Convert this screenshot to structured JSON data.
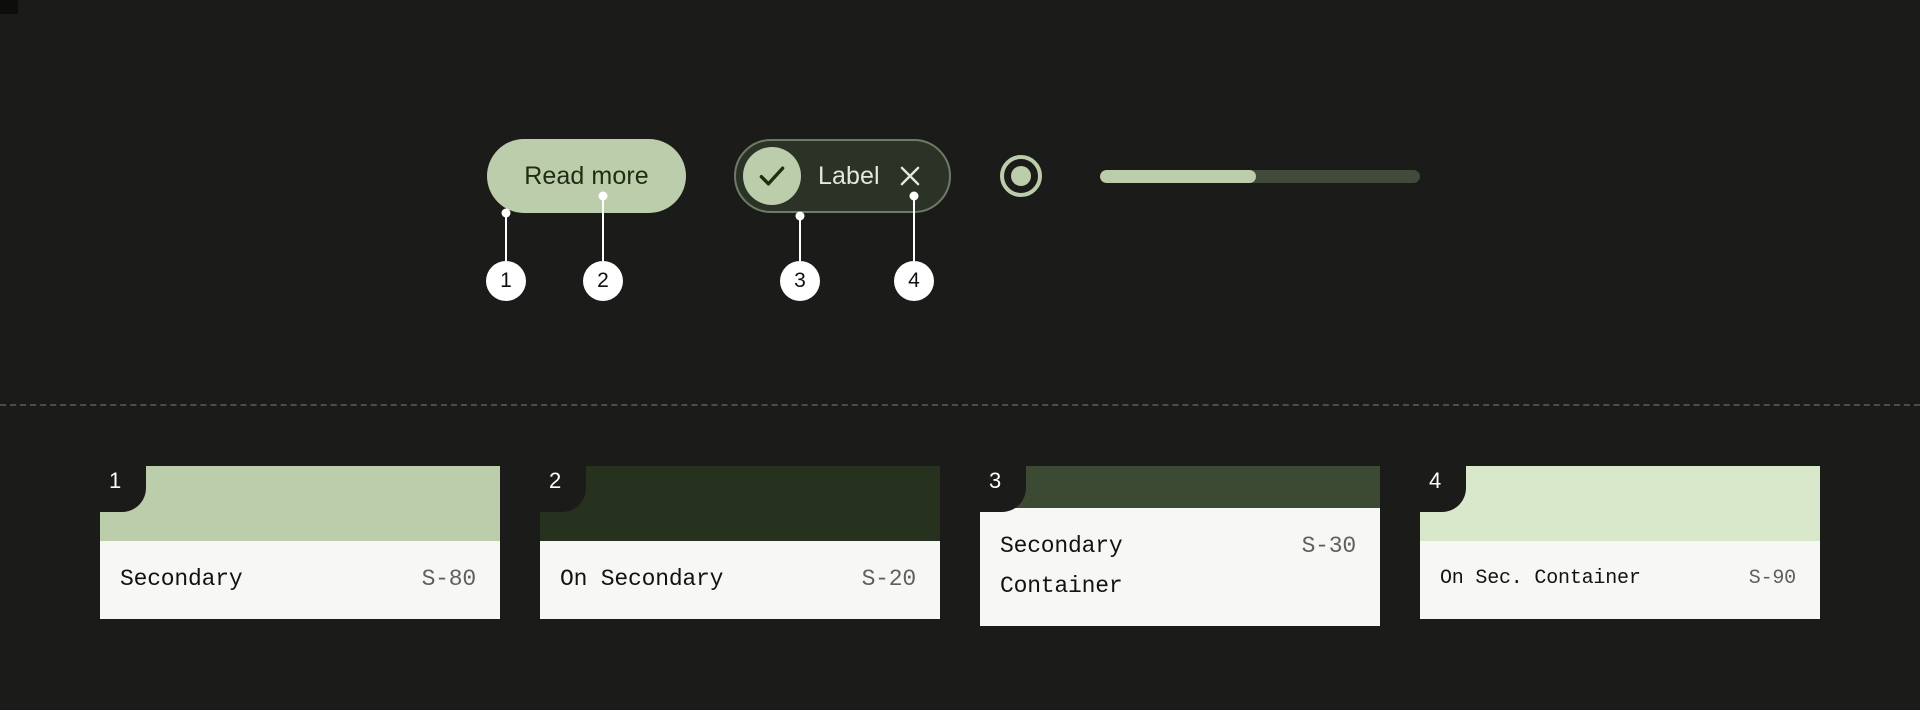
{
  "palette": {
    "background": "#1b1c19",
    "secondary": "#bccdab",
    "on_secondary": "#26321d",
    "secondary_container": "#3d4a33",
    "on_secondary_container": "#d9e7cb",
    "surface_light": "#f7f8f5",
    "callout_white": "#ffffff",
    "separator": "#4b4d48",
    "slider_track": "#424a3c",
    "chip_outline": "#6f7a66",
    "chip_surface": "#2b3327"
  },
  "showcase": {
    "button": {
      "label": "Read more"
    },
    "chip": {
      "label": "Label",
      "check_icon": "check-icon",
      "close_icon": "close-icon"
    },
    "radio": {
      "icon": "radio-selected-icon",
      "selected": true
    },
    "slider": {
      "icon": "slider-track",
      "value_percent": 49
    },
    "callouts": [
      {
        "number": "1",
        "target": "button-container"
      },
      {
        "number": "2",
        "target": "button-label"
      },
      {
        "number": "3",
        "target": "chip-avatar"
      },
      {
        "number": "4",
        "target": "chip-close-icon"
      }
    ]
  },
  "swatches": [
    {
      "number": "1",
      "name": "Secondary",
      "token": "S-80",
      "color": "#bccdab",
      "swatch_height": 75,
      "info_height": 55
    },
    {
      "number": "2",
      "name": "On Secondary",
      "token": "S-20",
      "color": "#26321d",
      "swatch_height": 75,
      "info_height": 55
    },
    {
      "number": "3",
      "name": "Secondary\nContainer",
      "token": "S-30",
      "color": "#3d4a33",
      "swatch_height": 42,
      "info_height": 88
    },
    {
      "number": "4",
      "name": "On Sec. Container",
      "token": "S-90",
      "color": "#d9e7cb",
      "swatch_height": 75,
      "info_height": 50
    }
  ]
}
